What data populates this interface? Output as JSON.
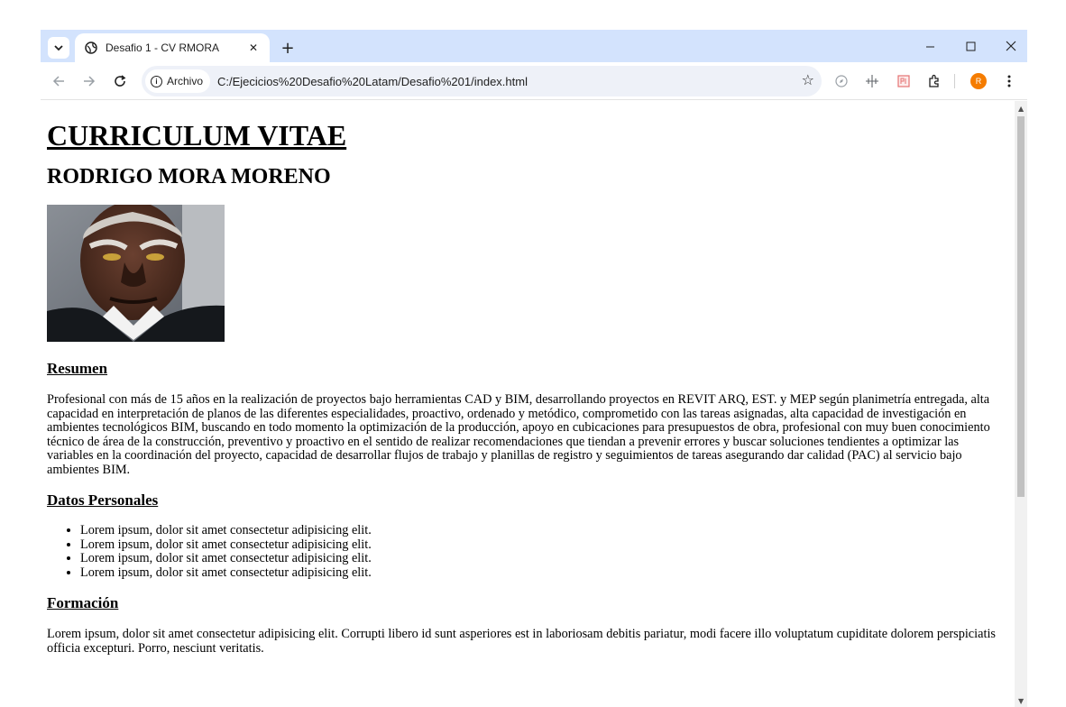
{
  "browser": {
    "tab_title": "Desafio 1 - CV RMORA",
    "tab_close": "✕",
    "new_tab": "+",
    "site_chip": "Archivo",
    "url": "C:/Ejecicios%20Desafio%20Latam/Desafio%201/index.html",
    "profile_initial": "R",
    "accent_color": "#d3e3fd"
  },
  "page": {
    "title": "CURRICULUM VITAE",
    "name": "RODRIGO MORA MORENO",
    "sections": {
      "resumen": {
        "heading": "Resumen",
        "text": "Profesional con más de 15 años en la realización de proyectos bajo herramientas CAD y BIM, desarrollando proyectos en REVIT ARQ, EST. y MEP según planimetría entregada, alta capacidad en interpretación de planos de las diferentes especialidades, proactivo, ordenado y metódico, comprometido con las tareas asignadas, alta capacidad de investigación en ambientes tecnológicos BIM, buscando en todo momento la optimización de la producción, apoyo en cubicaciones para presupuestos de obra, profesional con muy buen conocimiento técnico de área de la construcción, preventivo y proactivo en el sentido de realizar recomendaciones que tiendan a prevenir errores y buscar soluciones tendientes a optimizar las variables en la coordinación del proyecto, capacidad de desarrollar flujos de trabajo y planillas de registro y seguimientos de tareas asegurando dar calidad (PAC) al servicio bajo ambientes BIM."
      },
      "datos": {
        "heading": "Datos Personales",
        "items": [
          "Lorem ipsum, dolor sit amet consectetur adipisicing elit.",
          "Lorem ipsum, dolor sit amet consectetur adipisicing elit.",
          "Lorem ipsum, dolor sit amet consectetur adipisicing elit.",
          "Lorem ipsum, dolor sit amet consectetur adipisicing elit."
        ]
      },
      "formacion": {
        "heading": "Formación",
        "text": "Lorem ipsum, dolor sit amet consectetur adipisicing elit. Corrupti libero id sunt asperiores est in laboriosam debitis pariatur, modi facere illo voluptatum cupiditate dolorem perspiciatis officia excepturi. Porro, nesciunt veritatis."
      }
    }
  }
}
